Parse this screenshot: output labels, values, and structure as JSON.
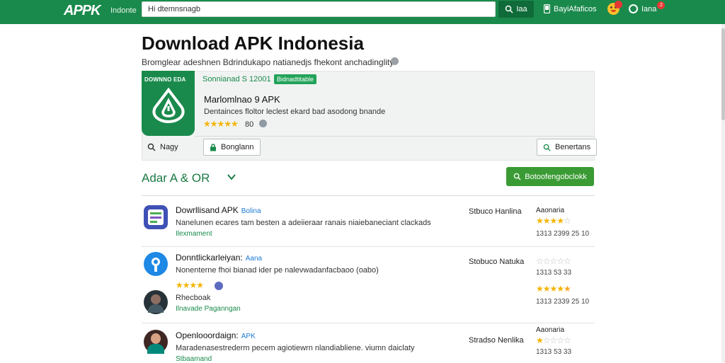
{
  "topbar": {
    "logo": "APPK",
    "logo_sub": "Indonte",
    "search_value": "Hi dtemnsnagb",
    "search_button": "Iaa",
    "link_1": "BayiAfaficos",
    "link_2": "Iana",
    "notification_count": "2"
  },
  "page": {
    "title": "Download APK Indonesia",
    "subtitle": "Bromglear adeshnen Bdrindukapo natianedjs fhekont anchadinglity"
  },
  "featured": {
    "tile_label": "DOWNNO EDA",
    "meta": "Sonnianad S 12001",
    "tag": "Bidnadtitable",
    "name": "Marlomlnao 9 APK",
    "description": "Dentainces floltor leclest ekard bad asodong bnande",
    "stars": "★★★★★",
    "rating": "80",
    "search_label": "Nagy",
    "button_left": "Bonglann",
    "button_right": "Benertans"
  },
  "section": {
    "title": "Adar A & OR",
    "action_button": "Botoofengobclokk"
  },
  "rows": [
    {
      "title": "Dowrllisand APK",
      "tag": "Bolina",
      "description": "Nanelunen ecares tam besten a adeiieraar ranais niaiebaneciant clackads",
      "link": "Ilexmament",
      "price": "Stbuco Hanlina",
      "label": "Aaonaria",
      "stars_on": "★★★★",
      "stars_off": "☆",
      "nums": "1313 2399 25 10"
    },
    {
      "title": "Donntlickarleiyan:",
      "tag": "Aana",
      "description": "Nonenterne fhoi bianad ider pe nalevwadanfacbaoo (oabo)",
      "link": "",
      "price": "Stobuco Natuka",
      "label": "",
      "stars_on": "",
      "stars_off": "☆☆☆☆☆",
      "nums": "1313 53 33"
    },
    {
      "title": "",
      "tag": "",
      "description": "Rhecboak",
      "link": "Ilnavade Paganngan",
      "price": "",
      "label": "",
      "stars_on": "★★★★",
      "stars_off": "",
      "mid_stars": "★★★★",
      "mid_stars_off": "",
      "nums": "1313 2339 25 10"
    },
    {
      "title": "Openlooordaign:",
      "tag": "APK",
      "description": "Maradenasestrederm pecem agiotiewrn nlandiabliene. viumn daiclaty",
      "link": "Stbaamand",
      "price": "Stradso Nenlika",
      "label": "Aaonaria",
      "stars_on": "★",
      "stars_off": "☆☆☆☆",
      "nums": "1313 53 33"
    }
  ],
  "colors": {
    "brand_green": "#1a8a4c",
    "button_green": "#3a9b34",
    "star_gold": "#f4b400"
  }
}
